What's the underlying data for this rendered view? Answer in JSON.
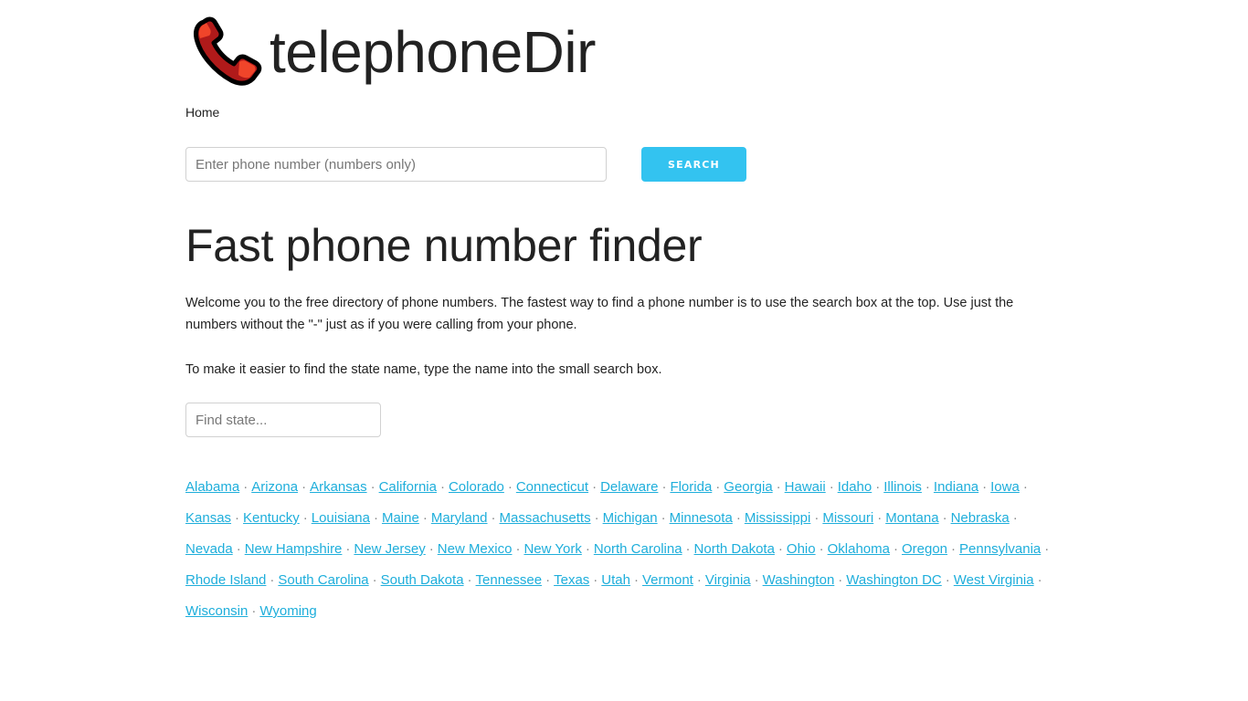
{
  "brand": {
    "name": "telephoneDir",
    "logo_icon": "telephone-receiver-icon",
    "logo_colors": {
      "outline": "#000000",
      "dark": "#b01a1a",
      "light": "#f0452a"
    }
  },
  "nav": {
    "items": [
      {
        "label": "Home"
      }
    ]
  },
  "search": {
    "placeholder": "Enter phone number (numbers only)",
    "value": "",
    "button_label": "SEARCH"
  },
  "main": {
    "title": "Fast phone number finder",
    "intro": "Welcome you to the free directory of phone numbers. The fastest way to find a phone number is to use the search box at the top. Use just the numbers without the \"-\" just as if you were calling from your phone.",
    "hint": "To make it easier to find the state name, type the name into the small search box.",
    "state_filter": {
      "placeholder": "Find state...",
      "value": ""
    }
  },
  "states": {
    "separator": "·",
    "items": [
      "Alabama",
      "Arizona",
      "Arkansas",
      "California",
      "Colorado",
      "Connecticut",
      "Delaware",
      "Florida",
      "Georgia",
      "Hawaii",
      "Idaho",
      "Illinois",
      "Indiana",
      "Iowa",
      "Kansas",
      "Kentucky",
      "Louisiana",
      "Maine",
      "Maryland",
      "Massachusetts",
      "Michigan",
      "Minnesota",
      "Mississippi",
      "Missouri",
      "Montana",
      "Nebraska",
      "Nevada",
      "New Hampshire",
      "New Jersey",
      "New Mexico",
      "New York",
      "North Carolina",
      "North Dakota",
      "Ohio",
      "Oklahoma",
      "Oregon",
      "Pennsylvania",
      "Rhode Island",
      "South Carolina",
      "South Dakota",
      "Tennessee",
      "Texas",
      "Utah",
      "Vermont",
      "Virginia",
      "Washington",
      "Washington DC",
      "West Virginia",
      "Wisconsin",
      "Wyoming"
    ]
  },
  "colors": {
    "accent": "#33c3f0",
    "link": "#1eaedb",
    "text": "#222222",
    "input_border": "#d1d1d1"
  }
}
